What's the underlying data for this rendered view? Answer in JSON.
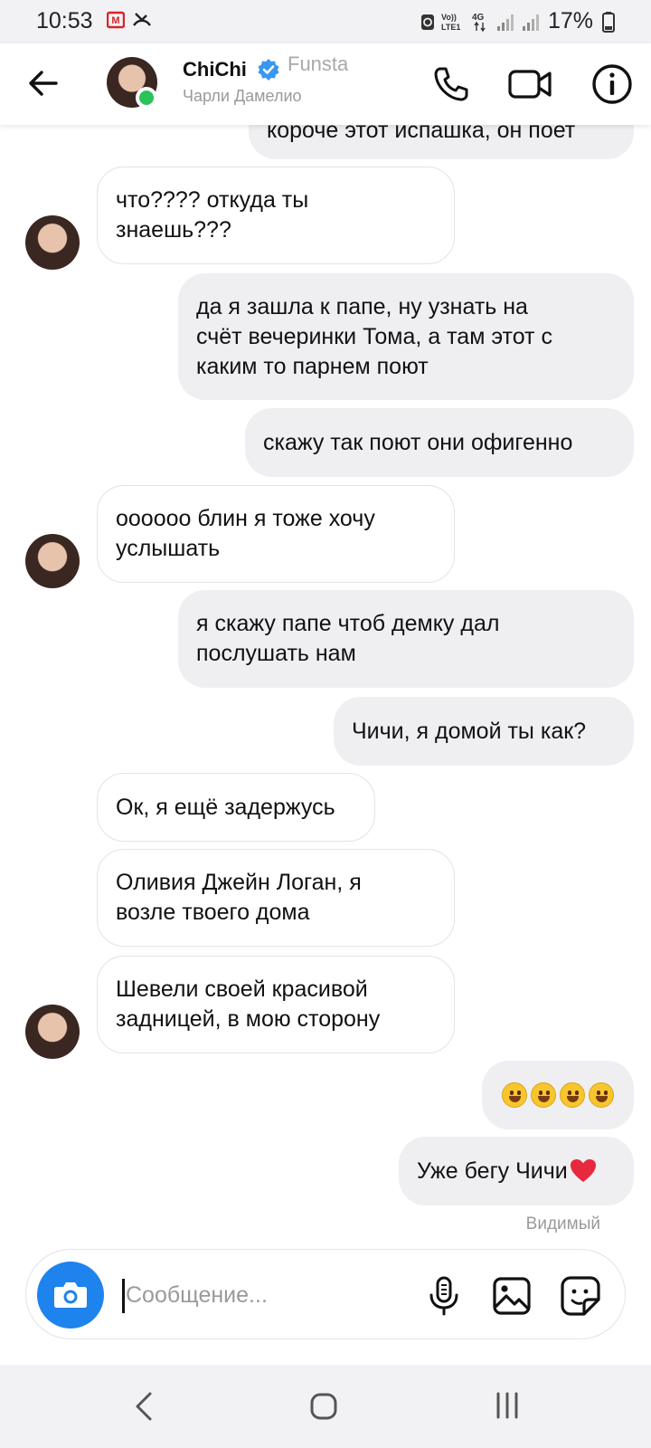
{
  "status_bar": {
    "time": "10:53",
    "battery": "17%"
  },
  "header": {
    "name": "ChiChi",
    "subtitle": "Чарли Дамелио",
    "watermark": "Funsta"
  },
  "messages": [
    {
      "side": "out",
      "text": "короче этот испашка, он поет"
    },
    {
      "side": "in",
      "text": "что???? откуда ты\nзнаешь???"
    },
    {
      "side": "out",
      "text": "да я зашла к папе, ну узнать на\nсчёт вечеринки Тома, а там этот с\nкаким то парнем поют"
    },
    {
      "side": "out",
      "text": "скажу так поют они офигенно"
    },
    {
      "side": "in",
      "text": "оооооо блин я тоже хочу\nуслышать"
    },
    {
      "side": "out",
      "text": "я скажу папе чтоб демку дал\nпослушать нам"
    },
    {
      "side": "out",
      "text": "Чичи, я домой ты как?"
    },
    {
      "side": "in",
      "text": "Ок, я ещё задержусь"
    },
    {
      "side": "in",
      "text": "Оливия Джейн Логан, я\nвозле твоего дома"
    },
    {
      "side": "in",
      "text": "Шевели своей красивой\nзадницей, в мою сторону"
    },
    {
      "side": "out",
      "text": "",
      "emoji": [
        "grinning-face",
        "grinning-face",
        "grinning-face",
        "grinning-face"
      ]
    },
    {
      "side": "out",
      "text": "Уже бегу Чичи",
      "emoji": [
        "red-heart"
      ]
    }
  ],
  "seen_label": "Видимый",
  "composer": {
    "placeholder": "Сообщение..."
  },
  "icons": {
    "status": [
      "message-notification-icon",
      "missed-call-icon",
      "recycle-icon",
      "volte-signal-icon",
      "4g-icon",
      "signal-icon",
      "signal-icon",
      "battery-icon"
    ],
    "header": [
      "back-arrow-icon",
      "verified-badge-icon",
      "phone-icon",
      "video-camera-icon",
      "info-icon"
    ],
    "composer": [
      "camera-icon",
      "microphone-icon",
      "gallery-icon",
      "sticker-icon"
    ],
    "nav": [
      "nav-back-icon",
      "nav-home-icon",
      "nav-recents-icon"
    ]
  },
  "colors": {
    "accent": "#1f83ee",
    "online": "#2bc25a",
    "verified": "#3897f0",
    "outgoing_bubble": "#efeff2",
    "heart": "#e8283c"
  }
}
